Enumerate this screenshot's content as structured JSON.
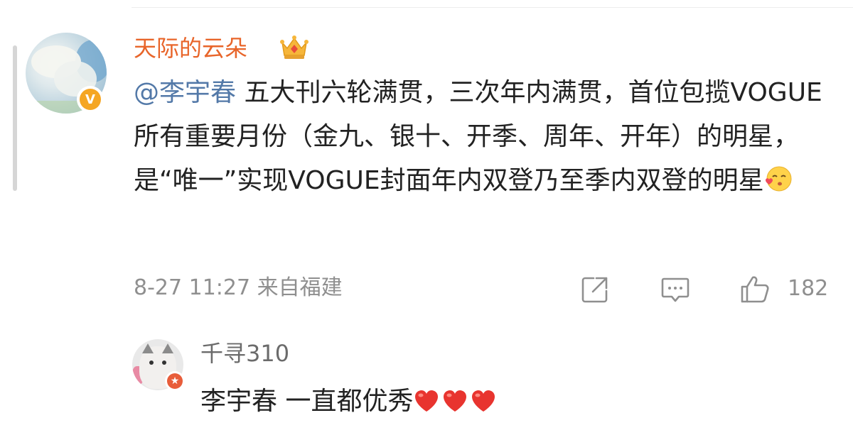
{
  "comment": {
    "username": "天际的云朵",
    "mention": "@李宇春",
    "text": "五大刊六轮满贯，三次年内满贯，首位包揽VOGUE所有重要月份（金九、银十、开季、周年、开年）的明星，是“唯一”实现VOGUE封面年内双登乃至季内双登的明星",
    "time": "8-27 11:27",
    "source": "来自福建",
    "like_count": "182",
    "name_color": "#e8652a",
    "mention_color": "#5379a8",
    "badge": "V",
    "icons": [
      "crown-icon",
      "kiss-emoji-icon",
      "share-icon",
      "comment-icon",
      "like-icon"
    ]
  },
  "reply": {
    "username": "千寻310",
    "text": "李宇春 一直都优秀",
    "hearts": 3,
    "name_color": "#6b6b6b",
    "icons": [
      "heart-emoji-icon"
    ]
  }
}
